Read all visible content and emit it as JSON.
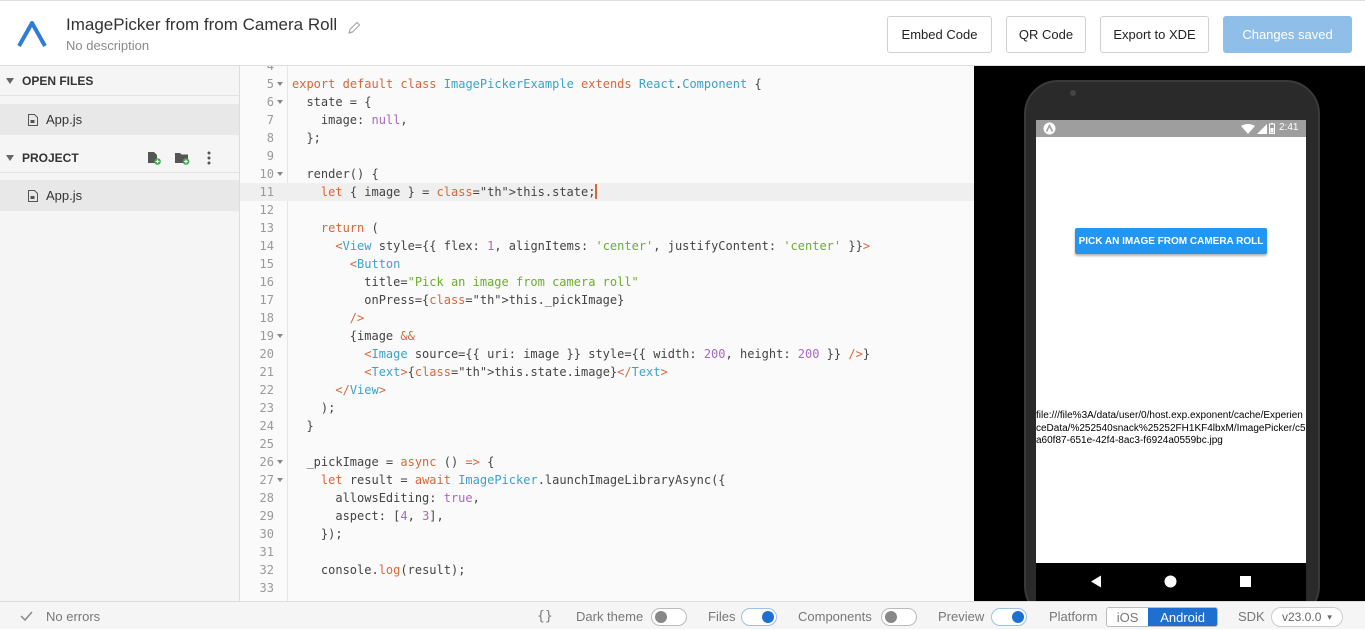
{
  "header": {
    "title": "ImagePicker from from Camera Roll",
    "description": "No description",
    "buttons": {
      "embed": "Embed Code",
      "qr": "QR Code",
      "export": "Export to XDE",
      "saved": "Changes saved"
    }
  },
  "sidebar": {
    "open_files_label": "OPEN FILES",
    "open_files": [
      {
        "name": "App.js"
      }
    ],
    "project_label": "PROJECT",
    "project_files": [
      {
        "name": "App.js"
      }
    ]
  },
  "editor": {
    "active_line": 11,
    "lines": [
      {
        "n": "4",
        "text": ""
      },
      {
        "n": "5",
        "text": "export default class ImagePickerExample extends React.Component {"
      },
      {
        "n": "6",
        "text": "  state = {"
      },
      {
        "n": "7",
        "text": "    image: null,"
      },
      {
        "n": "8",
        "text": "  };"
      },
      {
        "n": "9",
        "text": ""
      },
      {
        "n": "10",
        "text": "  render() {"
      },
      {
        "n": "11",
        "text": "    let { image } = this.state;"
      },
      {
        "n": "12",
        "text": ""
      },
      {
        "n": "13",
        "text": "    return ("
      },
      {
        "n": "14",
        "text": "      <View style={{ flex: 1, alignItems: 'center', justifyContent: 'center' }}>"
      },
      {
        "n": "15",
        "text": "        <Button"
      },
      {
        "n": "16",
        "text": "          title=\"Pick an image from camera roll\""
      },
      {
        "n": "17",
        "text": "          onPress={this._pickImage}"
      },
      {
        "n": "18",
        "text": "        />"
      },
      {
        "n": "19",
        "text": "        {image &&"
      },
      {
        "n": "20",
        "text": "          <Image source={{ uri: image }} style={{ width: 200, height: 200 }} />}"
      },
      {
        "n": "21",
        "text": "          <Text>{this.state.image}</Text>"
      },
      {
        "n": "22",
        "text": "      </View>"
      },
      {
        "n": "23",
        "text": "    );"
      },
      {
        "n": "24",
        "text": "  }"
      },
      {
        "n": "25",
        "text": ""
      },
      {
        "n": "26",
        "text": "  _pickImage = async () => {"
      },
      {
        "n": "27",
        "text": "    let result = await ImagePicker.launchImageLibraryAsync({"
      },
      {
        "n": "28",
        "text": "      allowsEditing: true,"
      },
      {
        "n": "29",
        "text": "      aspect: [4, 3],"
      },
      {
        "n": "30",
        "text": "    });"
      },
      {
        "n": "31",
        "text": ""
      },
      {
        "n": "32",
        "text": "    console.log(result);"
      },
      {
        "n": "33",
        "text": ""
      }
    ]
  },
  "preview": {
    "time": "2:41",
    "button_label": "PICK AN IMAGE FROM CAMERA ROLL",
    "uri_text": "file:///file%3A/data/user/0/host.exp.exponent/cache/ExperienceData/%252540snack%25252FH1KF4lbxM/ImagePicker/c5a60f87-651e-42f4-8ac3-f6924a0559bc.jpg"
  },
  "footer": {
    "errors": "No errors",
    "braces": "{}",
    "dark_theme": "Dark theme",
    "files": "Files",
    "components": "Components",
    "preview": "Preview",
    "platform": "Platform",
    "ios": "iOS",
    "android": "Android",
    "sdk_label": "SDK",
    "sdk_version": "v23.0.0"
  },
  "colors": {
    "accent": "#1d6fd0",
    "saved_button": "#8fbee8",
    "android_button": "#2196f3"
  }
}
